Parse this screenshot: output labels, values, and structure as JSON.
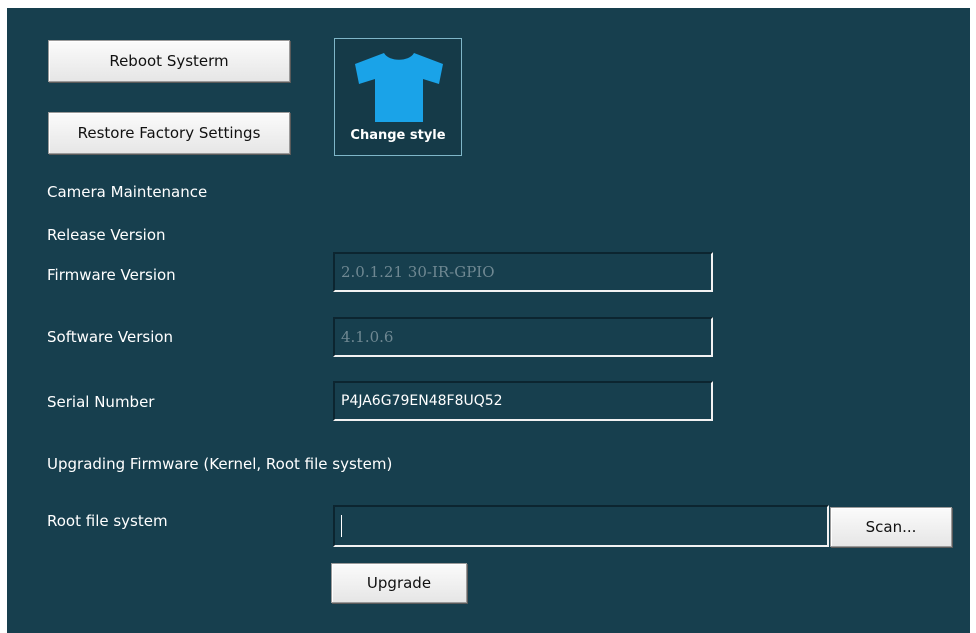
{
  "actions": {
    "reboot_label": "Reboot Systerm",
    "restore_label": "Restore Factory Settings",
    "change_style_label": "Change style"
  },
  "section_titles": {
    "maintenance": "Camera Maintenance",
    "release": "Release Version",
    "upgrade": "Upgrading Firmware (Kernel, Root file system)"
  },
  "info": {
    "firmware_label": "Firmware Version",
    "firmware_value": "2.0.1.21 30-IR-GPIO",
    "software_label": "Software Version",
    "software_value": "4.1.0.6",
    "serial_label": "Serial Number",
    "serial_value": "P4JA6G79EN48F8UQ52"
  },
  "upgrade": {
    "rootfs_label": "Root file system",
    "rootfs_value": "",
    "scan_label": "Scan...",
    "upgrade_label": "Upgrade"
  },
  "colors": {
    "panel_bg": "#173f4e",
    "shirt_icon": "#1aa3e8"
  },
  "icons": {
    "style_icon": "tshirt-icon"
  }
}
